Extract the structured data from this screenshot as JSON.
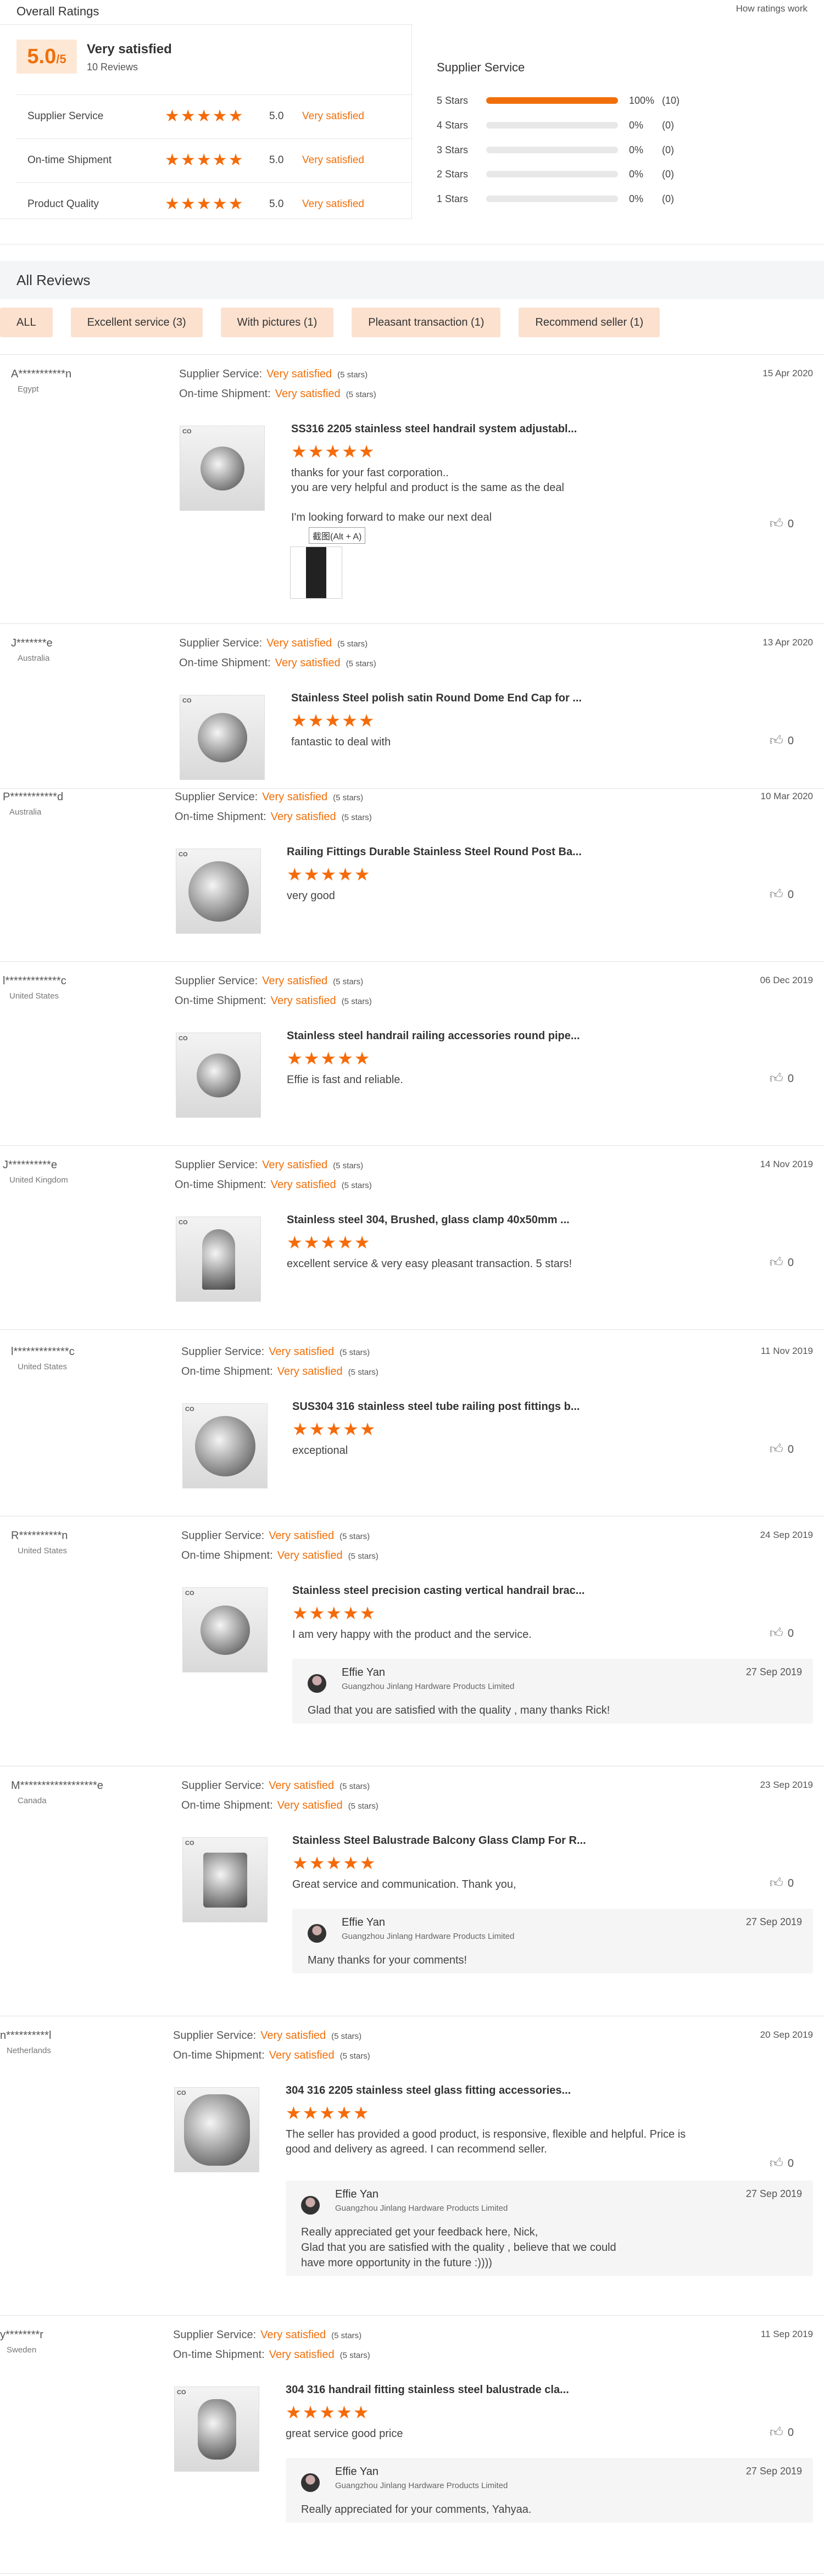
{
  "overall": {
    "title": "Overall Ratings",
    "how_link": "How ratings work",
    "score": "5.0",
    "score_suffix": "/5",
    "score_label": "Very satisfied",
    "review_count": "10 Reviews",
    "criteria": [
      {
        "name": "Supplier Service",
        "stars": "★★★★★",
        "value": "5.0",
        "label": "Very satisfied"
      },
      {
        "name": "On-time Shipment",
        "stars": "★★★★★",
        "value": "5.0",
        "label": "Very satisfied"
      },
      {
        "name": "Product Quality",
        "stars": "★★★★★",
        "value": "5.0",
        "label": "Very satisfied"
      }
    ]
  },
  "supplier_service": {
    "title": "Supplier Service",
    "rows": [
      {
        "label": "5 Stars",
        "fraction": 1.0,
        "pct": "100%",
        "count": "(10)"
      },
      {
        "label": "4 Stars",
        "fraction": 0,
        "pct": "0%",
        "count": "(0)"
      },
      {
        "label": "3 Stars",
        "fraction": 0,
        "pct": "0%",
        "count": "(0)"
      },
      {
        "label": "2 Stars",
        "fraction": 0,
        "pct": "0%",
        "count": "(0)"
      },
      {
        "label": "1 Stars",
        "fraction": 0,
        "pct": "0%",
        "count": "(0)"
      }
    ]
  },
  "all_reviews": {
    "title": "All Reviews",
    "filters": [
      "ALL",
      "Excellent service (3)",
      "With pictures (1)",
      "Pleasant transaction (1)",
      "Recommend seller (1)"
    ]
  },
  "labels": {
    "supplier_service": "Supplier Service:",
    "on_time": "On-time Shipment:",
    "very_satisfied": "Very satisfied",
    "five_stars": "(5 stars)",
    "stars": "★★★★★"
  },
  "tooltip": "截图(Alt + A)",
  "reviews": [
    {
      "buyer": "A***********n",
      "country": "Egypt",
      "date": "15 Apr 2020",
      "product": "SS316 2205 stainless steel handrail system adjustabl...",
      "text": [
        "thanks for your fast corporation..",
        "you are very helpful and product is the same as the deal",
        "",
        "I'm looking forward to make our next deal"
      ],
      "likes": "0"
    },
    {
      "buyer": "J*******e",
      "country": "Australia",
      "date": "13 Apr 2020",
      "product": "Stainless Steel polish satin Round Dome End Cap for ...",
      "text": [
        "fantastic to deal with"
      ],
      "likes": "0"
    },
    {
      "buyer": "P***********d",
      "country": "Australia",
      "date": "10 Mar 2020",
      "product": "Railing Fittings Durable Stainless Steel Round Post Ba...",
      "text": [
        "very good"
      ],
      "likes": "0"
    },
    {
      "buyer": "l*************c",
      "country": "United States",
      "date": "06 Dec 2019",
      "product": "Stainless steel handrail railing accessories round pipe...",
      "text": [
        "Effie is fast and reliable."
      ],
      "likes": "0"
    },
    {
      "buyer": "J**********e",
      "country": "United Kingdom",
      "date": "14 Nov 2019",
      "product": "Stainless steel 304, Brushed, glass clamp 40x50mm ...",
      "text": [
        "excellent service & very easy pleasant transaction. 5 stars!"
      ],
      "likes": "0"
    },
    {
      "buyer": "l*************c",
      "country": "United States",
      "date": "11 Nov 2019",
      "product": "SUS304 316 stainless steel tube railing post fittings b...",
      "text": [
        "exceptional"
      ],
      "likes": "0"
    },
    {
      "buyer": "R**********n",
      "country": "United States",
      "date": "24 Sep 2019",
      "product": "Stainless steel precision casting vertical handrail brac...",
      "text": [
        "I am very happy with the product and the service."
      ],
      "likes": "0",
      "reply": {
        "name": "Effie Yan",
        "company": "Guangzhou Jinlang Hardware Products Limited",
        "date": "27 Sep 2019",
        "text": [
          "Glad that you are satisfied with the quality , many thanks Rick!"
        ]
      }
    },
    {
      "buyer": "M******************e",
      "country": "Canada",
      "date": "23 Sep 2019",
      "product": "Stainless Steel Balustrade Balcony Glass Clamp For R...",
      "text": [
        "Great service and communication. Thank you,"
      ],
      "likes": "0",
      "reply": {
        "name": "Effie Yan",
        "company": "Guangzhou Jinlang Hardware Products Limited",
        "date": "27 Sep 2019",
        "text": [
          "Many thanks for your comments!"
        ]
      }
    },
    {
      "buyer": "n**********l",
      "country": "Netherlands",
      "date": "20 Sep 2019",
      "product": "304 316 2205 stainless steel glass fitting accessories...",
      "text": [
        "The seller has provided a good product, is responsive, flexible and helpful. Price is",
        "good and delivery as agreed. I can recommend seller."
      ],
      "likes": "0",
      "reply": {
        "name": "Effie Yan",
        "company": "Guangzhou Jinlang Hardware Products Limited",
        "date": "27 Sep 2019",
        "text": [
          "Really appreciated get your feedback here, Nick,",
          "Glad that you are satisfied with the quality , believe that we could",
          "have more opportunity in the future :))))"
        ]
      }
    },
    {
      "buyer": "y********r",
      "country": "Sweden",
      "date": "11 Sep 2019",
      "product": "304 316 handrail fitting stainless steel balustrade cla...",
      "text": [
        "great service good price"
      ],
      "likes": "0",
      "reply": {
        "name": "Effie Yan",
        "company": "Guangzhou Jinlang Hardware Products Limited",
        "date": "27 Sep 2019",
        "text": [
          "Really appreciated for your comments, Yahyaa."
        ]
      }
    }
  ]
}
